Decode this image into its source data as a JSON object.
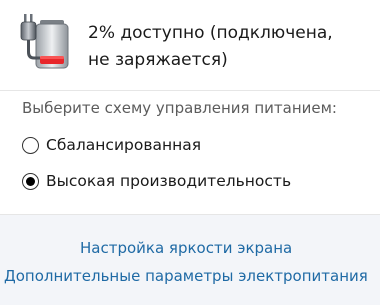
{
  "status": {
    "line1": "2% доступно (подключена,",
    "line2": "не заряжается)"
  },
  "scheme": {
    "heading": "Выберите схему управления питанием:",
    "options": [
      {
        "label": "Сбалансированная",
        "selected": false
      },
      {
        "label": "Высокая производительность",
        "selected": true
      }
    ]
  },
  "links": {
    "brightness": "Настройка яркости экрана",
    "power_options": "Дополнительные параметры электропитания"
  },
  "colors": {
    "link": "#1f6aa5",
    "footer_bg": "#f3f5f9",
    "battery_low": "#e8262a"
  }
}
